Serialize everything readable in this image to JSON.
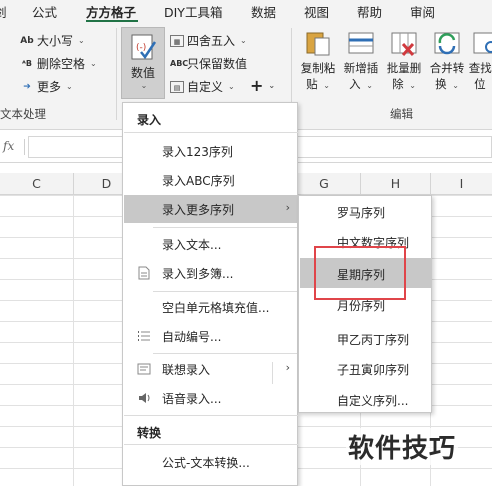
{
  "menu_tabs": [
    "剑",
    "公式",
    "方方格子",
    "DIY工具箱",
    "数据",
    "视图",
    "帮助",
    "审阅"
  ],
  "ribbon": {
    "text_group": {
      "upper_lower": "大小写",
      "delete_spaces": "删除空格",
      "more": "更多",
      "label": "文本处理"
    },
    "value_button": "数值",
    "rounding": "四舍五入",
    "keep_values": "只保留数值",
    "custom": "自定义",
    "plus": "+",
    "edit_buttons": [
      {
        "label": "复制粘",
        "label2": "贴"
      },
      {
        "label": "新增插",
        "label2": "入"
      },
      {
        "label": "批量删",
        "label2": "除"
      },
      {
        "label": "合并转",
        "label2": "换"
      },
      {
        "label": "查找定",
        "label2": "位"
      }
    ],
    "edit_group_label": "编辑"
  },
  "formula_bar": {
    "fx": "fx"
  },
  "columns": [
    "C",
    "D",
    "G",
    "H",
    "I"
  ],
  "main_menu": {
    "section_entry": "录入",
    "items": [
      {
        "label": "录入123序列"
      },
      {
        "label": "录入ABC序列"
      },
      {
        "label": "录入更多序列",
        "submenu": true,
        "highlighted": true
      },
      {
        "label": "录入文本..."
      },
      {
        "label": "录入到多簿...",
        "icon": "document-icon"
      },
      {
        "label": "空白单元格填充值..."
      },
      {
        "label": "自动编号...",
        "icon": "numbered-list-icon"
      },
      {
        "label": "联想录入",
        "icon": "associate-icon",
        "submenu": true
      },
      {
        "label": "语音录入...",
        "icon": "speaker-icon"
      }
    ],
    "section_convert": "转换",
    "convert_items": [
      {
        "label": "公式-文本转换..."
      }
    ]
  },
  "submenu": {
    "items": [
      {
        "label": "罗马序列"
      },
      {
        "label": "中文数字序列"
      },
      {
        "label": "星期序列",
        "highlighted": true
      },
      {
        "label": "月份序列"
      },
      {
        "label": "甲乙丙丁序列"
      },
      {
        "label": "子丑寅卯序列"
      },
      {
        "label": "自定义序列..."
      }
    ]
  },
  "watermark": "软件技巧",
  "colors": {
    "highlight": "#c8c8c8",
    "red_box": "#e0454a",
    "accent": "#217346"
  }
}
